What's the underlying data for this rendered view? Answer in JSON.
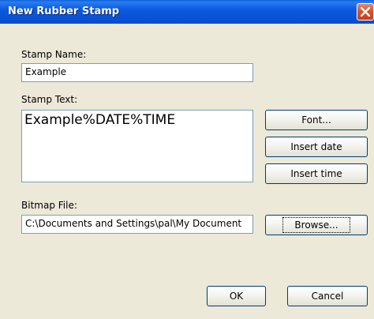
{
  "window": {
    "title": "New Rubber Stamp"
  },
  "stamp_name": {
    "label": "Stamp Name:",
    "value": "Example"
  },
  "stamp_text": {
    "label": "Stamp Text:",
    "value": "Example%DATE%TIME",
    "font_button": "Font...",
    "insert_date_button": "Insert date",
    "insert_time_button": "Insert time"
  },
  "bitmap": {
    "label": "Bitmap File:",
    "value": "C:\\Documents and Settings\\pal\\My Document",
    "browse_button": "Browse..."
  },
  "footer": {
    "ok_button": "OK",
    "cancel_button": "Cancel"
  }
}
